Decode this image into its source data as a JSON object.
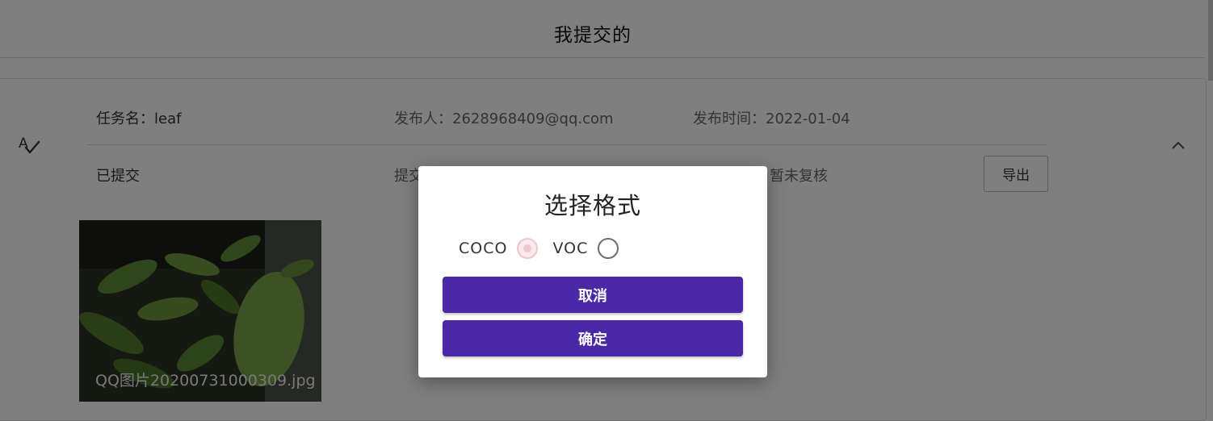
{
  "header": {
    "title": "我提交的"
  },
  "task": {
    "name": "任务名：leaf",
    "publisher": "发布人：2628968409@qq.com",
    "publish_time": "发布时间：2022-01-04",
    "status": "已提交",
    "submit_partial": "提交",
    "review_partial": "核",
    "review_status": "暂未复核",
    "export_label": "导出"
  },
  "image": {
    "caption": "QQ图片20200731000309.jpg"
  },
  "dialog": {
    "title": "选择格式",
    "options": [
      {
        "label": "COCO",
        "selected": true
      },
      {
        "label": "VOC",
        "selected": false
      }
    ],
    "cancel_label": "取消",
    "confirm_label": "确定"
  },
  "colors": {
    "primary": "#4a28a6",
    "radio_selected": "#f0c6cd",
    "overlay": "rgba(0,0,0,0.5)"
  },
  "icons": [
    "spellcheck-icon",
    "chevron-up-icon",
    "radio-checked-icon",
    "radio-unchecked-icon"
  ]
}
